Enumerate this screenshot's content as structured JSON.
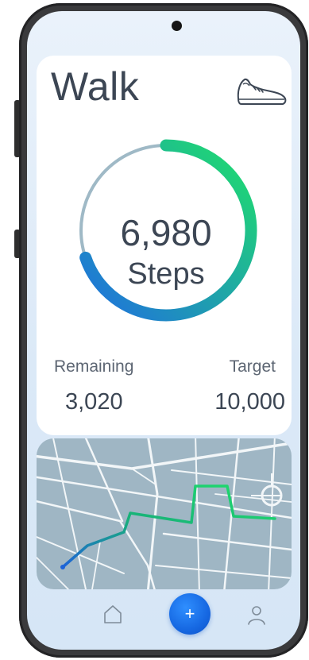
{
  "app": {
    "title": "Walk",
    "icon": "sneaker-icon"
  },
  "progress": {
    "steps_display": "6,980",
    "steps_unit": "Steps",
    "steps": 6980,
    "target_steps": 10000,
    "fraction": 0.698
  },
  "stats": {
    "remaining_label": "Remaining",
    "remaining_value": "3,020",
    "target_label": "Target",
    "target_value": "10,000"
  },
  "map": {
    "route_icon": "route-line",
    "destination_icon": "destination-circle-icon"
  },
  "nav": {
    "home_icon": "home-icon",
    "add_label": "+",
    "add_icon": "plus-icon",
    "profile_icon": "user-icon"
  },
  "colors": {
    "ring_start": "#1f6fe0",
    "ring_end": "#1fe06a",
    "ring_track": "#9fb9c6",
    "text": "#3c4654",
    "map_background": "#9fb6c4",
    "accent": "#1668e2"
  }
}
